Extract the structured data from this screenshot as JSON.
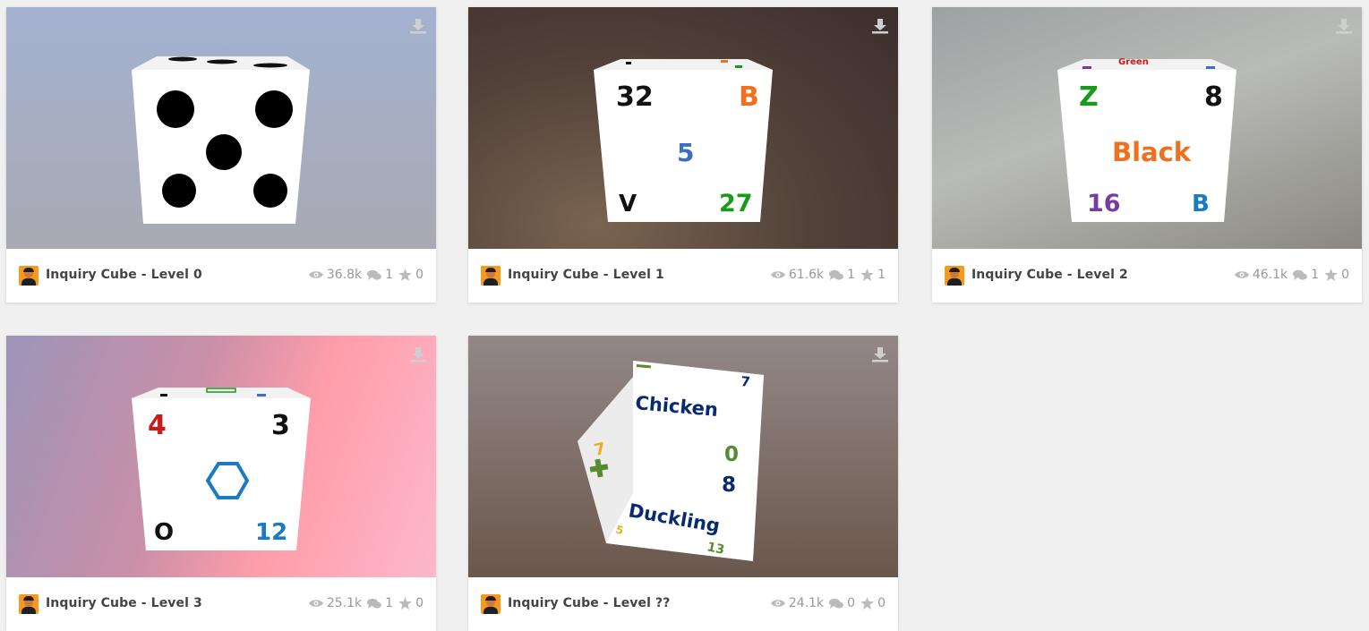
{
  "cards": [
    {
      "title": "Inquiry Cube - Level 0",
      "views": "36.8k",
      "comments": "1",
      "likes": "0"
    },
    {
      "title": "Inquiry Cube - Level 1",
      "views": "61.6k",
      "comments": "1",
      "likes": "1"
    },
    {
      "title": "Inquiry Cube - Level 2",
      "views": "46.1k",
      "comments": "1",
      "likes": "0"
    },
    {
      "title": "Inquiry Cube - Level 3",
      "views": "25.1k",
      "comments": "1",
      "likes": "0"
    },
    {
      "title": "Inquiry Cube - Level ??",
      "views": "24.1k",
      "comments": "0",
      "likes": "0"
    }
  ],
  "cube1": {
    "tl": "32",
    "tr": "B",
    "center": "5",
    "bl": "V",
    "br": "27"
  },
  "cube2": {
    "top": "Green",
    "tl": "Z",
    "tr": "8",
    "center": "Black",
    "bl": "16",
    "br": "B"
  },
  "cube3": {
    "tl": "4",
    "tr": "3",
    "bl": "O",
    "br": "12"
  },
  "cube4": {
    "word1": "Chicken",
    "word2": "Duckling",
    "n7": "7",
    "n0": "0",
    "n8": "8",
    "n7b": "7",
    "n5": "5",
    "n13": "13"
  },
  "icons": {
    "views": "eye-icon",
    "comments": "comments-icon",
    "likes": "star-icon",
    "download": "download-icon"
  },
  "colors": {
    "orange": "#f07020",
    "green": "#1a9a1a",
    "blue": "#3a6fc4",
    "purple": "#7a3aa0",
    "red": "#cc1a1a",
    "navy": "#0a2a6e",
    "olive": "#5a8a30",
    "yellow": "#e8b020"
  }
}
